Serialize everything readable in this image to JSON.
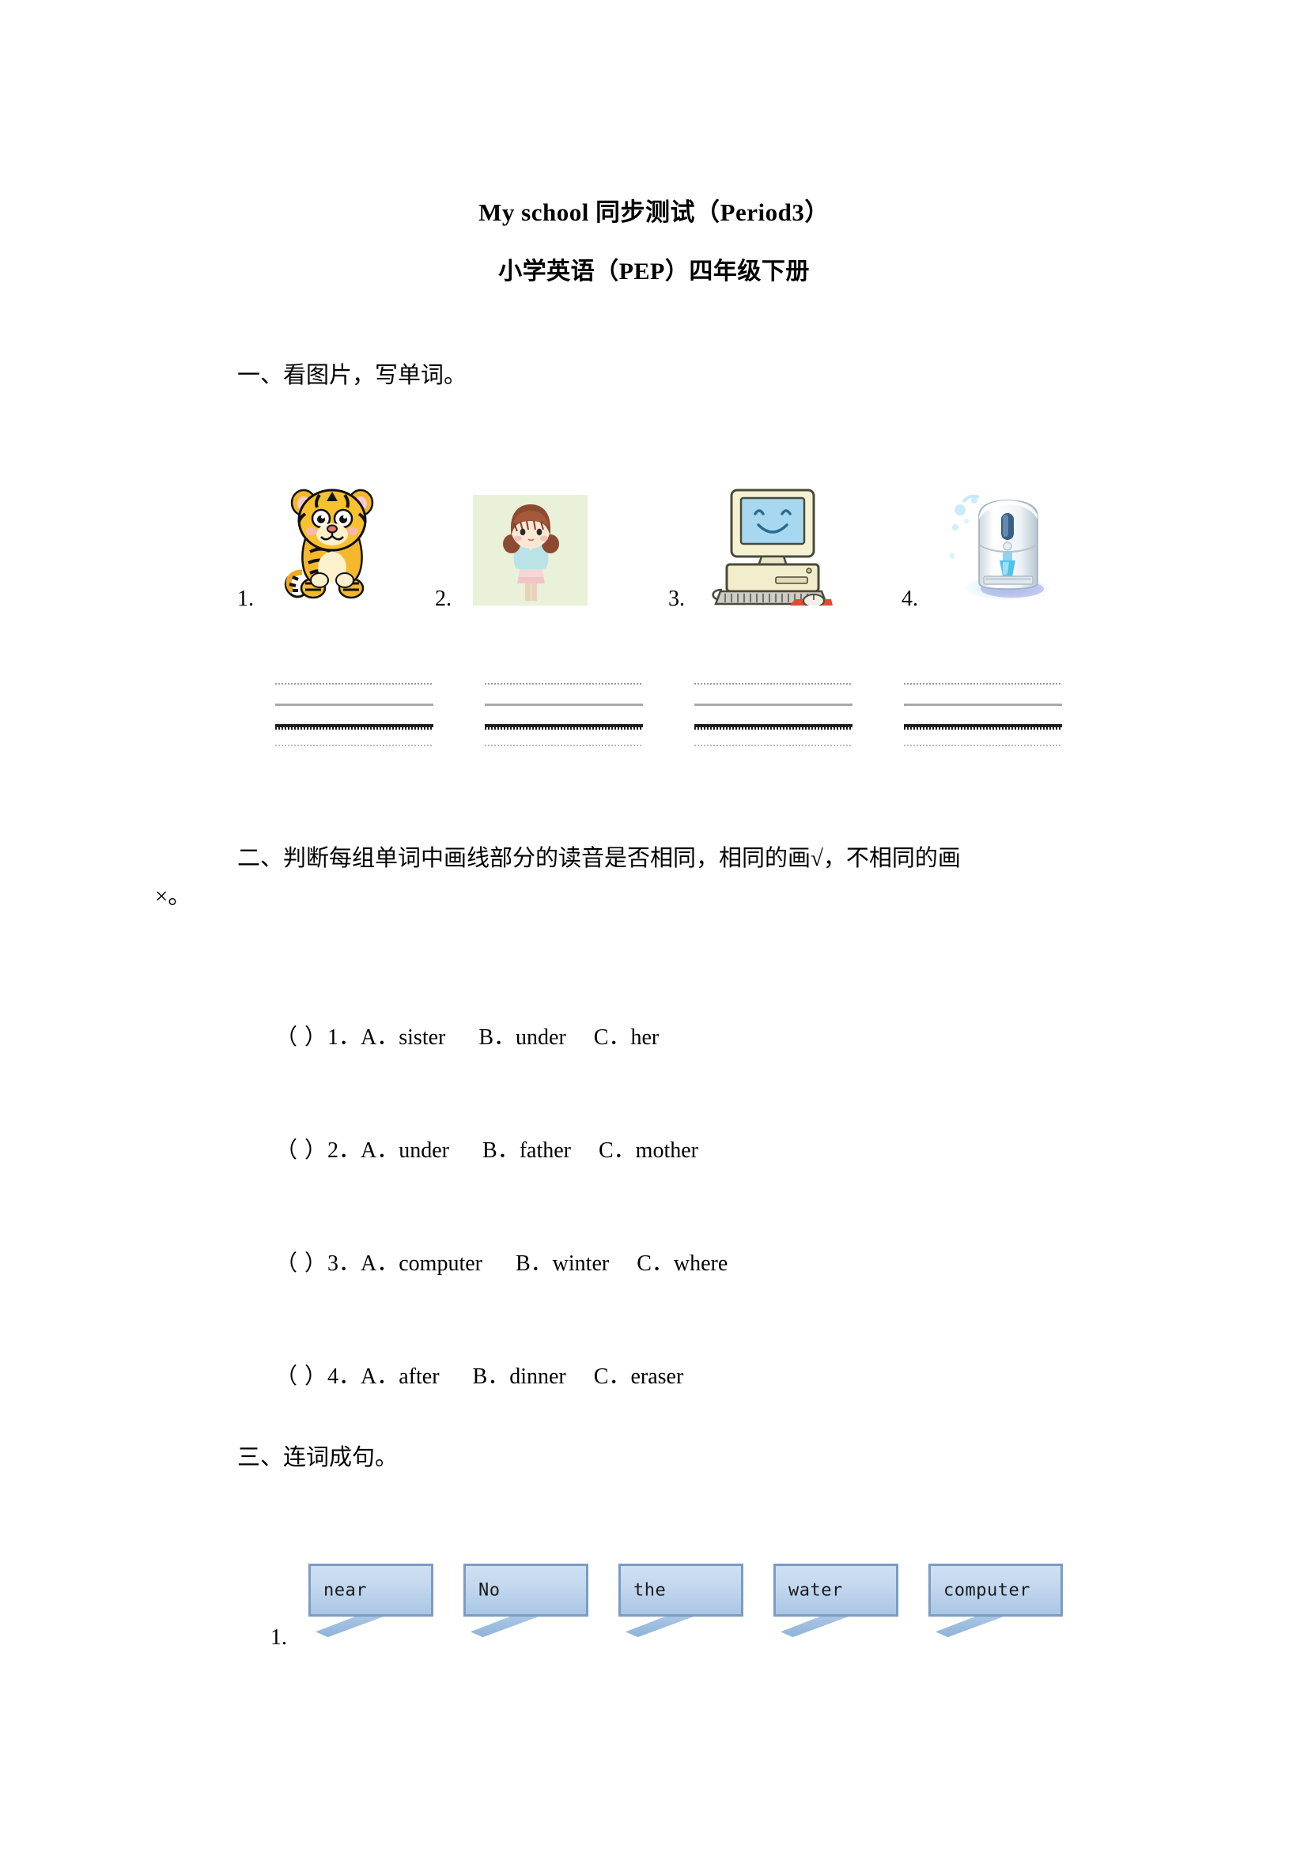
{
  "document": {
    "title_main": "My school 同步测试（Period3）",
    "title_sub": "小学英语（PEP）四年级下册"
  },
  "sections": [
    {
      "heading": "一、看图片，写单词。",
      "pictures": [
        {
          "number": "1.",
          "icon": "tiger-illustration",
          "answer_lines": 4
        },
        {
          "number": "2.",
          "icon": "girl-illustration",
          "answer_lines": 4
        },
        {
          "number": "3.",
          "icon": "computer-illustration",
          "answer_lines": 4
        },
        {
          "number": "4.",
          "icon": "water-dispenser-illustration",
          "answer_lines": 4
        }
      ]
    },
    {
      "heading_line1": "二、判断每组单词中画线部分的读音是否相同，相同的画√，不相同的画",
      "heading_line2": "×。",
      "questions": [
        {
          "blank": "（ ）",
          "number": "1．",
          "a": "A．sister",
          "b": "B．under",
          "c": "C．her"
        },
        {
          "blank": "（ ）",
          "number": "2．",
          "a": "A．under",
          "b": "B．father",
          "c": "C．mother"
        },
        {
          "blank": "（ ）",
          "number": "3．",
          "a": "A．computer",
          "b": "B．winter",
          "c": "C．where"
        },
        {
          "blank": "（ ）",
          "number": "4．",
          "a": "A．after",
          "b": "B．dinner",
          "c": "C．eraser"
        }
      ]
    },
    {
      "heading": "三、连词成句。",
      "item_number": "1.",
      "word_cards": [
        "near",
        "No",
        "the",
        "water",
        "computer"
      ]
    }
  ],
  "colors": {
    "card_fill_top": "#cfe0f2",
    "card_fill_bottom": "#a9c6e4",
    "card_border": "#7b9cc2",
    "girl_background": "#e9f1d9",
    "text": "#000000"
  }
}
